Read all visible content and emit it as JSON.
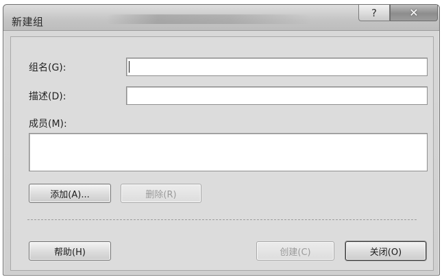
{
  "window": {
    "title": "新建组"
  },
  "titlebar": {
    "help_glyph": "?",
    "close_glyph": "✕"
  },
  "form": {
    "group_name_label": "组名(G):",
    "group_name_value": "",
    "description_label": "描述(D):",
    "description_value": "",
    "members_label": "成员(M):"
  },
  "buttons": {
    "add": "添加(A)...",
    "remove": "删除(R)",
    "help": "帮助(H)",
    "create": "创建(C)",
    "close": "关闭(O)"
  }
}
